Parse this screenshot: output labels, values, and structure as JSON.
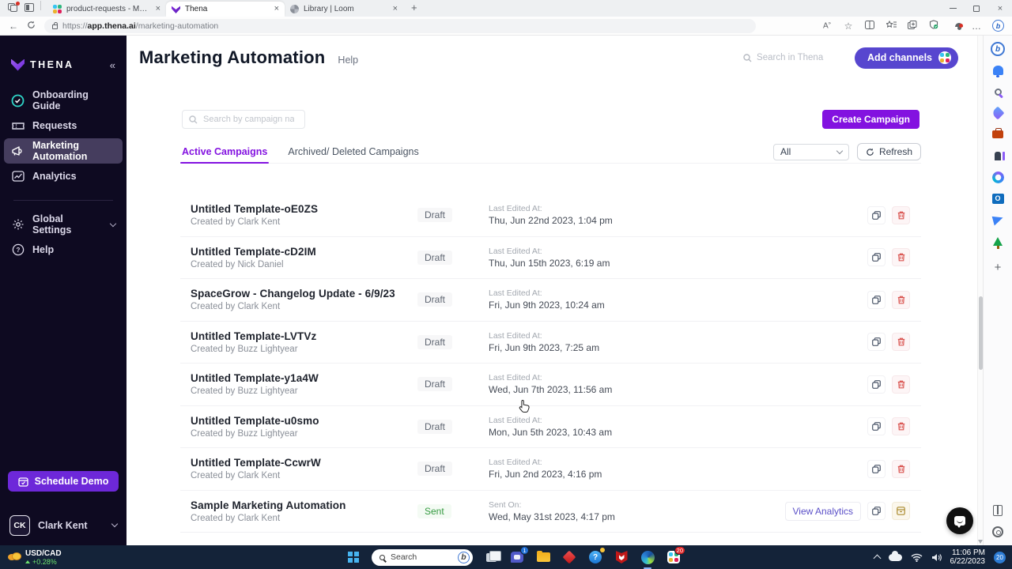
{
  "colors": {
    "accent_purple": "#8312E0",
    "button_indigo": "#5746CF",
    "schedule_purple": "#6D28D9",
    "sent_green": "#359A41",
    "draft_gray": "#5F6672",
    "delete_red": "#D9534F",
    "sidebar_bg": "#0E0A21",
    "taskbar_bg": "#142339"
  },
  "browser": {
    "tabs": [
      {
        "title": "product-requests - Manage Slac",
        "icon": "slack-icon"
      },
      {
        "title": "Thena",
        "icon": "thena-icon"
      },
      {
        "title": "Library | Loom",
        "icon": "loom-icon"
      }
    ],
    "url": {
      "scheme": "https://",
      "host": "app.thena.ai",
      "path": "/marketing-automation"
    },
    "toolbar_icons": [
      "read-aloud",
      "favorite-star",
      "split-screen",
      "collections",
      "add-collection",
      "browser-essentials",
      "profile",
      "more-menu",
      "bing-chat"
    ]
  },
  "glyphs": {
    "close": "×",
    "new_tab": "+",
    "collapse": "«",
    "ellipsis": "…",
    "read_aloud": "A",
    "star": "☆",
    "question": "?",
    "bing": "b",
    "outlook": "O",
    "plus": "+"
  },
  "sidebar": {
    "logo": "THENA",
    "items": [
      {
        "label": "Onboarding Guide",
        "icon": "check-circle-icon"
      },
      {
        "label": "Requests",
        "icon": "ticket-icon"
      },
      {
        "label": "Marketing Automation",
        "icon": "megaphone-icon",
        "active": true
      },
      {
        "label": "Analytics",
        "icon": "chart-icon"
      }
    ],
    "secondary": [
      {
        "label": "Global Settings",
        "icon": "gear-icon"
      },
      {
        "label": "Help",
        "icon": "help-circle-icon"
      }
    ],
    "schedule_demo": "Schedule Demo",
    "user": {
      "initials": "CK",
      "name": "Clark Kent"
    }
  },
  "header": {
    "title": "Marketing Automation",
    "help": "Help",
    "search_placeholder": "Search in Thena",
    "add_channels": "Add channels"
  },
  "campaigns": {
    "search_placeholder": "Search by campaign name",
    "create_button": "Create Campaign",
    "tabs": [
      {
        "label": "Active Campaigns",
        "active": true
      },
      {
        "label": "Archived/ Deleted Campaigns",
        "active": false
      }
    ],
    "filter_value": "All",
    "refresh_label": "Refresh",
    "view_analytics_label": "View Analytics",
    "rows": [
      {
        "name": "Untitled Template-oE0ZS",
        "creator": "Created by Clark Kent",
        "status": "Draft",
        "date_label": "Last Edited At:",
        "date_value": "Thu, Jun 22nd 2023, 1:04 pm",
        "actions": [
          "copy",
          "delete"
        ]
      },
      {
        "name": "Untitled Template-cD2IM",
        "creator": "Created by Nick Daniel",
        "status": "Draft",
        "date_label": "Last Edited At:",
        "date_value": "Thu, Jun 15th 2023, 6:19 am",
        "actions": [
          "copy",
          "delete"
        ]
      },
      {
        "name": "SpaceGrow - Changelog Update - 6/9/23",
        "creator": "Created by Clark Kent",
        "status": "Draft",
        "date_label": "Last Edited At:",
        "date_value": "Fri, Jun 9th 2023, 10:24 am",
        "actions": [
          "copy",
          "delete"
        ]
      },
      {
        "name": "Untitled Template-LVTVz",
        "creator": "Created by Buzz Lightyear",
        "status": "Draft",
        "date_label": "Last Edited At:",
        "date_value": "Fri, Jun 9th 2023, 7:25 am",
        "actions": [
          "copy",
          "delete"
        ]
      },
      {
        "name": "Untitled Template-y1a4W",
        "creator": "Created by Buzz Lightyear",
        "status": "Draft",
        "date_label": "Last Edited At:",
        "date_value": "Wed, Jun 7th 2023, 11:56 am",
        "actions": [
          "copy",
          "delete"
        ]
      },
      {
        "name": "Untitled Template-u0smo",
        "creator": "Created by Buzz Lightyear",
        "status": "Draft",
        "date_label": "Last Edited At:",
        "date_value": "Mon, Jun 5th 2023, 10:43 am",
        "actions": [
          "copy",
          "delete"
        ]
      },
      {
        "name": "Untitled Template-CcwrW",
        "creator": "Created by Clark Kent",
        "status": "Draft",
        "date_label": "Last Edited At:",
        "date_value": "Fri, Jun 2nd 2023, 4:16 pm",
        "actions": [
          "copy",
          "delete"
        ]
      },
      {
        "name": "Sample Marketing Automation",
        "creator": "Created by Clark Kent",
        "status": "Sent",
        "date_label": "Sent On:",
        "date_value": "Wed, May 31st 2023, 4:17 pm",
        "actions": [
          "view-analytics",
          "copy",
          "archive"
        ]
      }
    ]
  },
  "edge_sidebar": {
    "icons": [
      "bing-chat",
      "notifications-bell",
      "search",
      "shopping-tag",
      "toolbox",
      "office-people",
      "loop",
      "outlook",
      "send",
      "tree",
      "add-custom"
    ],
    "bottom_icons": [
      "journal",
      "settings"
    ]
  },
  "taskbar": {
    "widget": {
      "pair": "USD/CAD",
      "change": "+0.28%"
    },
    "search_placeholder": "Search",
    "icons": [
      "start",
      "search",
      "task-view",
      "teams-chat",
      "file-explorer",
      "diamond-app",
      "get-help",
      "mcafee",
      "edge",
      "slack"
    ],
    "badges": {
      "teams_chat": "1",
      "slack": "20",
      "tray_notifications": "20"
    },
    "clock": {
      "time": "11:06 PM",
      "date": "6/22/2023"
    }
  }
}
